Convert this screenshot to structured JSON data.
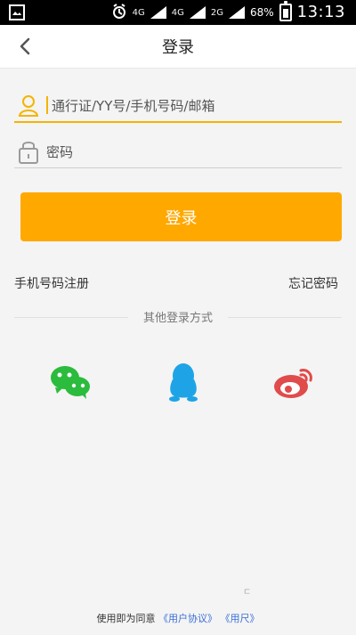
{
  "status_bar": {
    "network_a": "4G",
    "network_b": "4G",
    "network_c": "2G",
    "battery": "68%",
    "time": "13:13",
    "alarm_icon": "alarm-icon"
  },
  "nav": {
    "back_icon": "chevron-left-icon",
    "title": "登录"
  },
  "form": {
    "account_label": "通行证/YY号/手机号码/邮箱",
    "password_label": "密码",
    "login_button": "登录"
  },
  "links": {
    "register": "手机号码注册",
    "forgot": "忘记密码"
  },
  "other": {
    "divider_text": "其他登录方式"
  },
  "social": [
    {
      "name": "wechat",
      "icon": "wechat-icon"
    },
    {
      "name": "qq",
      "icon": "qq-icon"
    },
    {
      "name": "weibo",
      "icon": "weibo-icon"
    }
  ],
  "footer": {
    "prefix": "使用即为同意",
    "user_agreement": "《用户协议》",
    "user_other": "《用尺》"
  },
  "colors": {
    "accent_orange": "#ffa800",
    "field_active": "#f4b400",
    "wechat_green": "#2bbb3d",
    "qq_blue": "#1ea4e6",
    "weibo_red": "#e04b4b"
  },
  "misc": {
    "stray_mark": "ㄷ"
  }
}
